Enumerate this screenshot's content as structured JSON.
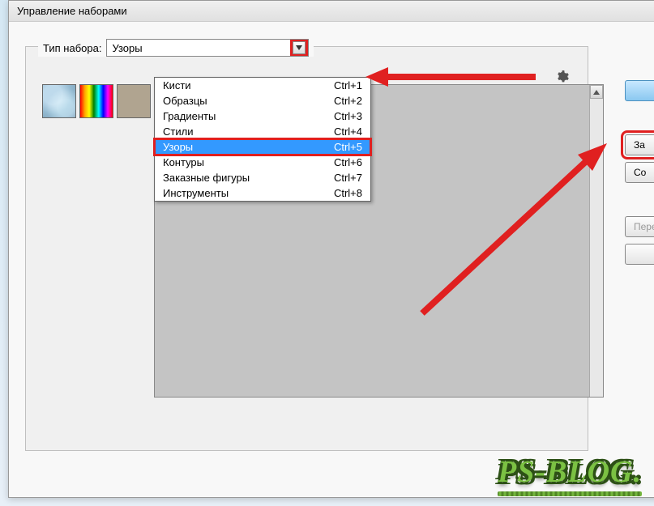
{
  "window": {
    "title": "Управление наборами"
  },
  "fieldset": {
    "label": "Тип набора:",
    "selected": "Узоры"
  },
  "dropdown_items": [
    {
      "label": "Кисти",
      "shortcut": "Ctrl+1",
      "selected": false
    },
    {
      "label": "Образцы",
      "shortcut": "Ctrl+2",
      "selected": false
    },
    {
      "label": "Градиенты",
      "shortcut": "Ctrl+3",
      "selected": false
    },
    {
      "label": "Стили",
      "shortcut": "Ctrl+4",
      "selected": false
    },
    {
      "label": "Узоры",
      "shortcut": "Ctrl+5",
      "selected": true
    },
    {
      "label": "Контуры",
      "shortcut": "Ctrl+6",
      "selected": false
    },
    {
      "label": "Заказные фигуры",
      "shortcut": "Ctrl+7",
      "selected": false
    },
    {
      "label": "Инструменты",
      "shortcut": "Ctrl+8",
      "selected": false
    }
  ],
  "buttons": {
    "done": "",
    "load": "За",
    "save": "Со",
    "rename": "Пере",
    "delete": ""
  },
  "watermark": "PS-BLOG."
}
